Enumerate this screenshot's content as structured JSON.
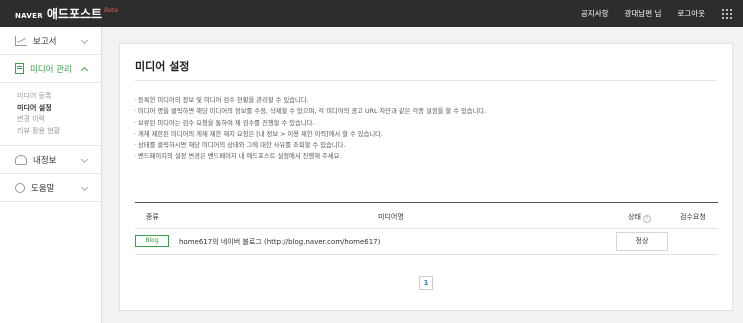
{
  "header": {
    "naver_logo": "NAVER",
    "product_name": "애드포스트",
    "beta_tag": "Beta",
    "nav": [
      "공지사항",
      "광대남편 님",
      "로그아웃"
    ]
  },
  "sidebar": {
    "menus": [
      {
        "label": "보고서",
        "icon": "report-chart-icon"
      },
      {
        "label": "미디어 관리",
        "icon": "media-document-icon"
      },
      {
        "label": "내정보",
        "icon": "user-icon"
      },
      {
        "label": "도움말",
        "icon": "help-icon"
      }
    ],
    "submenu": [
      "미디어 등록",
      "미디어 설정",
      "변경 이력",
      "리뷰 활용 현황"
    ]
  },
  "main": {
    "title": "미디어 설정",
    "notes": [
      "· 등록한 미디어의 정보 및 미디어 검수 현황을 관리할 수 있습니다.",
      "· 미디어 명을 클릭하면 해당 미디어의 정보를 수정, 삭제할 수 있으며, 각 미디어의 광고 URL 차단과 같은 각종 설정을 할 수 있습니다.",
      "· 보류된 미디어는 검수 요청을 통하여 재 검수를 진행할 수 있습니다.",
      "· 게재 제한된 미디어의 게재 제한 해지 요청은 [내 정보 > 이용 제한 이력]에서 할 수 있습니다.",
      "· 상태를 클릭하시면 해당 미디어의 상태와 그에 대한 사유를 조회할 수 있습니다.",
      "· 밴드페이지의 설정 변경은 밴드페이지 내 애드포스트 설정에서 진행해 주세요."
    ],
    "table": {
      "headers": {
        "type": "종류",
        "media_name": "미디어명",
        "status": "상태",
        "review": "검수요청",
        "help_mark": "?"
      },
      "rows": [
        {
          "type": "Blog",
          "media_name": "home617의 네이버 블로그 (http://blog.naver.com/home617)",
          "status": "정상"
        }
      ]
    },
    "pagination": {
      "current_page": "1"
    }
  },
  "colors": {
    "accent_green": "#3b9e4a",
    "topbar": "#2d2d2d",
    "page_link": "#3a7bd5"
  }
}
